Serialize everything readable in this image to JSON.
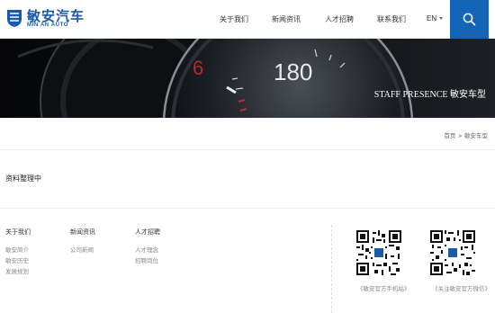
{
  "header": {
    "logo_cn": "敏安汽车",
    "logo_en": "MIN AN AUTO",
    "nav": [
      "关于我们",
      "新闻资讯",
      "人才招聘",
      "联系我们"
    ],
    "lang": "EN",
    "accent_color": "#1565b6"
  },
  "banner": {
    "speed_number": "180",
    "gear_number": "6",
    "caption": "STAFF PRESENCE 敏安车型"
  },
  "breadcrumb": "首页 > 敏安车型",
  "content": {
    "text": "资料整理中"
  },
  "footer": {
    "columns": [
      {
        "title": "关于我们",
        "links": [
          "敏安简介",
          "敏安历史",
          "发展规划"
        ]
      },
      {
        "title": "新闻资讯",
        "links": [
          "公司新闻"
        ]
      },
      {
        "title": "人才招聘",
        "links": [
          "人才理念",
          "招聘岗位"
        ]
      }
    ],
    "qr_codes": [
      {
        "caption": "《敏安官方手机站》",
        "icon": "qr-code"
      },
      {
        "caption": "《关注敏安官方微信》",
        "icon": "qr-code"
      }
    ]
  }
}
